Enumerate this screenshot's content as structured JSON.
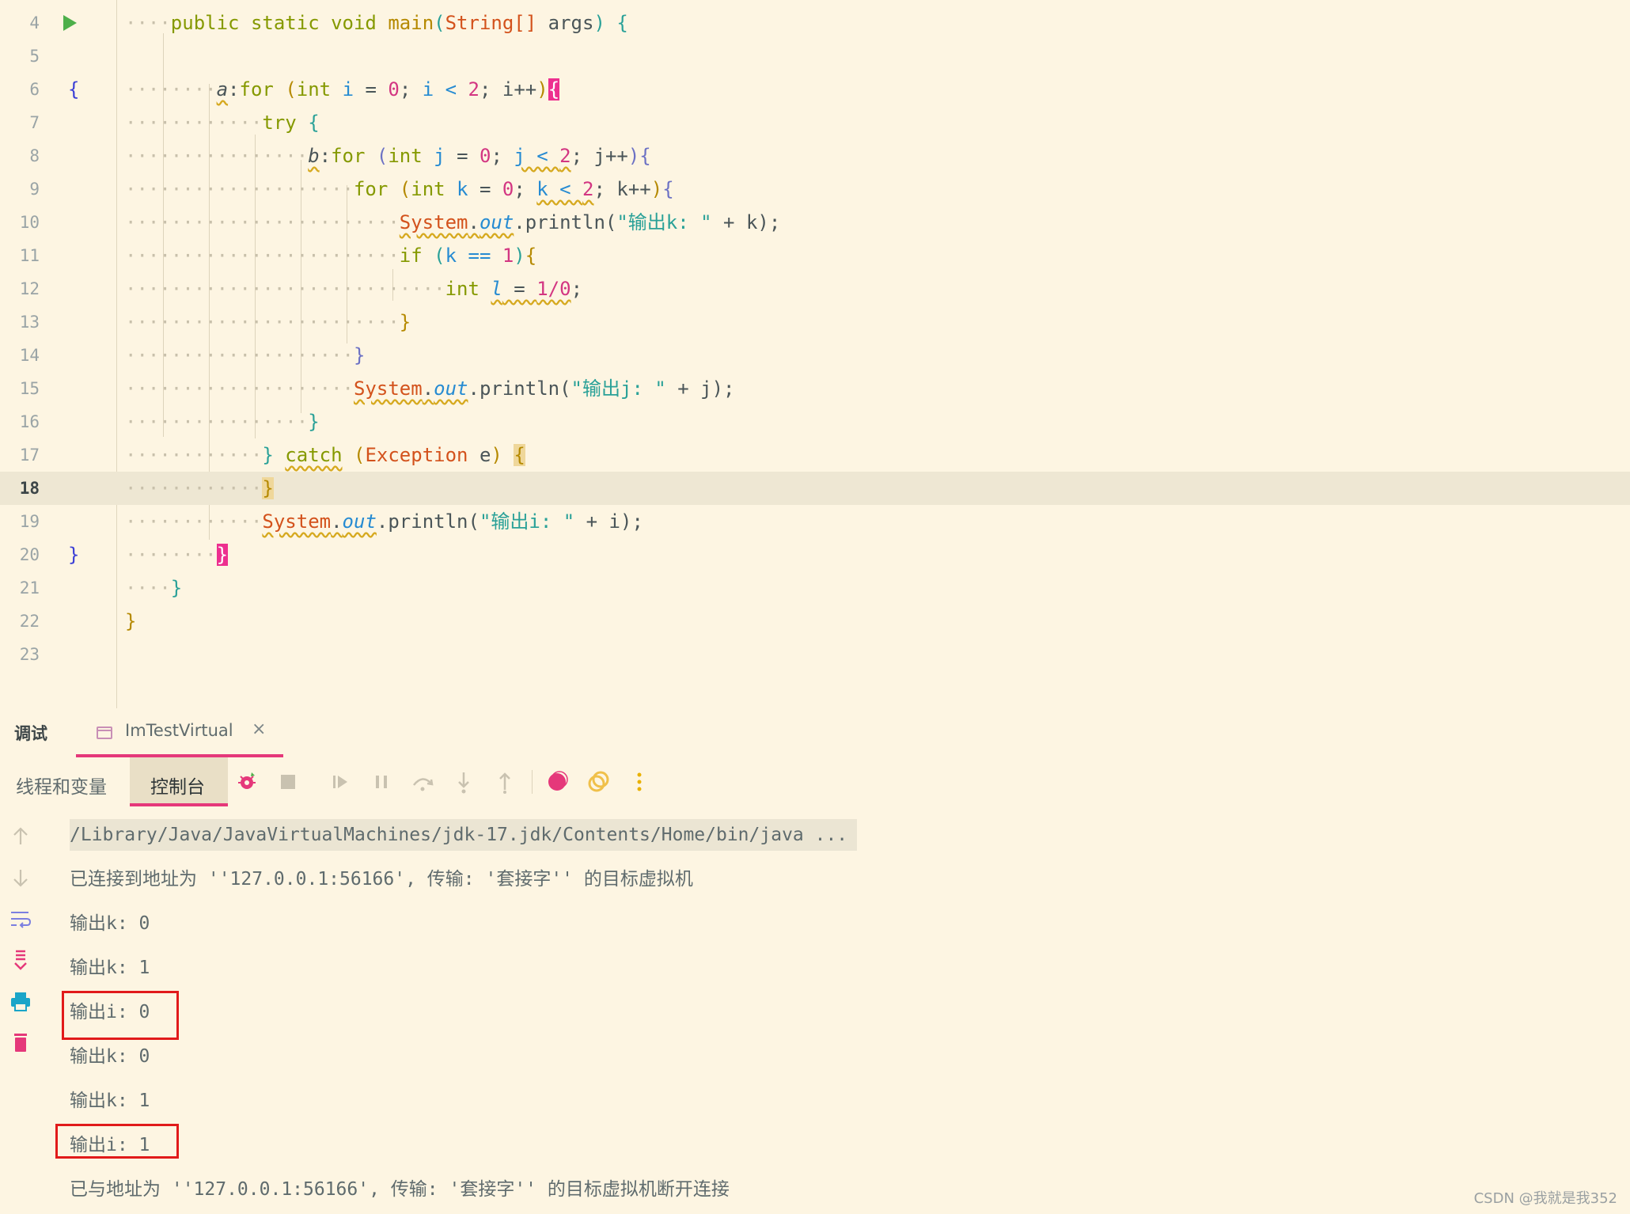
{
  "editor": {
    "lines": [
      {
        "n": "4",
        "gutter": "run"
      },
      {
        "n": "5"
      },
      {
        "n": "6",
        "gutter": "{"
      },
      {
        "n": "7"
      },
      {
        "n": "8"
      },
      {
        "n": "9"
      },
      {
        "n": "10"
      },
      {
        "n": "11"
      },
      {
        "n": "12"
      },
      {
        "n": "13"
      },
      {
        "n": "14"
      },
      {
        "n": "15"
      },
      {
        "n": "16"
      },
      {
        "n": "17"
      },
      {
        "n": "18"
      },
      {
        "n": "19"
      },
      {
        "n": "20",
        "gutter": "}"
      },
      {
        "n": "21"
      },
      {
        "n": "22"
      },
      {
        "n": "23"
      }
    ],
    "current_line": "18",
    "code": {
      "l4": {
        "mods": "public static void ",
        "name": "main",
        "type": "String[]",
        "param": " args",
        "open": "{"
      },
      "l6": {
        "label": "a",
        "kw": "for",
        "int": "int",
        "v": "i",
        "z": "0",
        "lt": "i < ",
        "two": "2",
        "inc": " i++",
        "open": "{"
      },
      "l7": {
        "kw": "try",
        "open": "{"
      },
      "l8": {
        "label": "b",
        "kw": "for",
        "int": "int",
        "v": "j",
        "z": "0",
        "lt": "j < ",
        "two": "2",
        "inc": " j++",
        "open": "{"
      },
      "l9": {
        "kw": "for",
        "int": "int",
        "v": "k",
        "z": "0",
        "lt": "k < ",
        "two": "2",
        "inc": " k++",
        "open": "{"
      },
      "l10": {
        "sys": "System",
        "out": "out",
        "call": ".println(",
        "str": "\"输出k: \"",
        "rest": " + k);"
      },
      "l11": {
        "kw": "if",
        "cond": "k == ",
        "one": "1",
        "close": ")",
        "open": "{"
      },
      "l12": {
        "int": "int",
        "v": "l",
        "eq": " = ",
        "expr": "1/0",
        ";": ";"
      },
      "l13": {
        "close": "}"
      },
      "l14": {
        "close": "}"
      },
      "l15": {
        "sys": "System",
        "out": "out",
        "call": ".println(",
        "str": "\"输出j: \"",
        "rest": " + j);"
      },
      "l16": {
        "close": "}"
      },
      "l17": {
        "close": "}",
        "kw": "catch",
        "type": "Exception",
        "param": " e",
        "open": "{"
      },
      "l18": {
        "close": "}"
      },
      "l19": {
        "sys": "System",
        "out": "out",
        "call": ".println(",
        "str": "\"输出i: \"",
        "rest": " + i);"
      },
      "l20": {
        "close": "}"
      },
      "l21": {
        "close": "}"
      },
      "l22": {
        "close": "}"
      }
    }
  },
  "panel": {
    "title": "调试",
    "session_tab": "ImTestVirtual",
    "tabs": {
      "threads": "线程和变量",
      "console": "控制台"
    },
    "toolbar_icons": [
      "rerun-debug-icon",
      "stop-icon",
      "resume-icon",
      "pause-icon",
      "step-over-icon",
      "step-into-icon",
      "step-out-icon",
      "view-breakpoints-icon",
      "mute-breakpoints-icon",
      "more-icon"
    ],
    "side_icons": [
      "scroll-up-icon",
      "scroll-down-icon",
      "soft-wrap-icon",
      "scroll-to-end-icon",
      "print-icon",
      "clear-icon"
    ],
    "console_lines": [
      "/Library/Java/JavaVirtualMachines/jdk-17.jdk/Contents/Home/bin/java ...",
      "已连接到地址为 ''127.0.0.1:56166', 传输: '套接字'' 的目标虚拟机",
      "输出k: 0",
      "输出k: 1",
      "输出i: 0",
      "输出k: 0",
      "输出k: 1",
      "输出i: 1",
      "已与地址为 ''127.0.0.1:56166', 传输: '套接字'' 的目标虚拟机断开连接"
    ]
  },
  "watermark": "CSDN @我就是我352",
  "colors": {
    "accent": "#e5387a",
    "highlight_box": "#e11a1a",
    "background": "#fdf5e2"
  }
}
